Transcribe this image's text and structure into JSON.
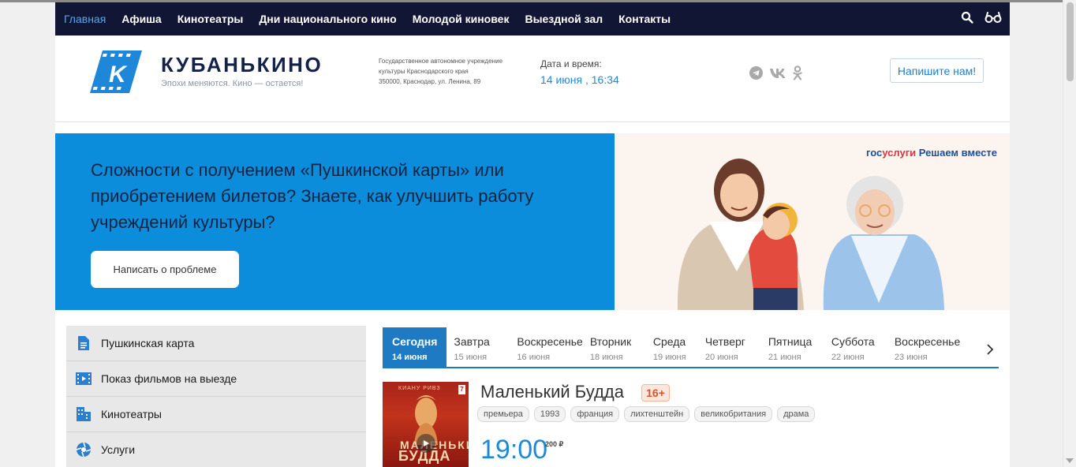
{
  "nav": {
    "items": [
      "Главная",
      "Афиша",
      "Кинотеатры",
      "Дни национального кино",
      "Молодой киновек",
      "Выездной зал",
      "Контакты"
    ],
    "icons": [
      "search-icon",
      "accessibility-glasses-icon"
    ]
  },
  "header": {
    "brand": "КУБАНЬКИНО",
    "tagline": "Эпохи меняются. Кино — остается!",
    "org_line1": "Государственное автономное учреждение",
    "org_line2": "культуры Краснодарского края",
    "org_line3": "350000, Краснодар, ул. Ленина, 89",
    "datetime_label": "Дата и время:",
    "datetime_value": "14 июня ,  16:34",
    "socials": [
      "telegram-icon",
      "vk-icon",
      "odnoklassniki-icon"
    ],
    "write_button": "Напишите нам!"
  },
  "banner": {
    "title": "Сложности с получением «Пушкинской карты» или приобретением билетов? Знаете, как улучшить работу учреждений культуры?",
    "button": "Написать о проблеме",
    "gos_part1": "гос",
    "gos_part2": "услуги",
    "gos_slogan": "Решаем вместе"
  },
  "sidebar": {
    "items": [
      {
        "label": "Пушкинская карта",
        "icon": "document-icon"
      },
      {
        "label": "Показ фильмов на выезде",
        "icon": "film-icon"
      },
      {
        "label": "Кинотеатры",
        "icon": "building-icon"
      },
      {
        "label": "Услуги",
        "icon": "aperture-icon"
      }
    ]
  },
  "days": [
    {
      "name": "Сегодня",
      "date": "14 июня"
    },
    {
      "name": "Завтра",
      "date": "15 июня"
    },
    {
      "name": "Воскресенье",
      "date": "16 июня"
    },
    {
      "name": "Вторник",
      "date": "18 июня"
    },
    {
      "name": "Среда",
      "date": "19 июня"
    },
    {
      "name": "Четверг",
      "date": "20 июня"
    },
    {
      "name": "Пятница",
      "date": "21 июня"
    },
    {
      "name": "Суббота",
      "date": "22 июня"
    },
    {
      "name": "Воскресенье",
      "date": "23 июня"
    }
  ],
  "movie": {
    "title": "Маленький Будда",
    "age": "16+",
    "tags": [
      "премьера",
      "1993",
      "франция",
      "лихтенштейн",
      "великобритания",
      "драма"
    ],
    "poster_top": "КИАНУ РИВЗ",
    "poster_title1": "МАЛЕНЬКИЙ",
    "poster_title2": "БУДДА",
    "poster_age": "7",
    "session_time": "19:00",
    "session_price": "200 ₽"
  },
  "colors": {
    "nav_bg": "#101634",
    "accent": "#1e7ac3",
    "banner_bg": "#0b8ddc",
    "age_badge": "#d1562b"
  }
}
